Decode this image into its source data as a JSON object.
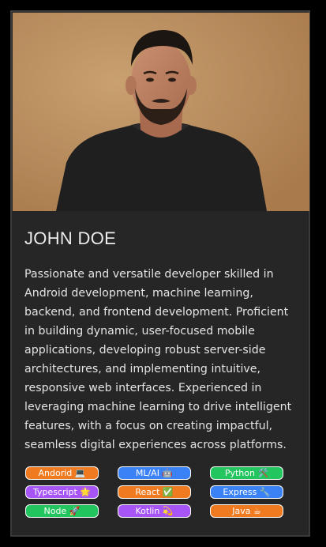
{
  "profile": {
    "name": "JOHN DOE",
    "bio": "Passionate and versatile developer skilled in Android development, machine learning, backend, and frontend development. Proficient in building dynamic, user-focused mobile applications, developing robust server-side architectures, and implementing intuitive, responsive web interfaces. Experienced in leveraging machine learning to drive intelligent features, with a focus on creating impactful, seamless digital experiences across platforms."
  },
  "photo": {
    "icon": "person-portrait"
  },
  "tags": [
    {
      "label": "Andorid 💻",
      "color": "#f07a1f"
    },
    {
      "label": "ML/AI 🤖",
      "color": "#3b82f6"
    },
    {
      "label": "Python 🛠️",
      "color": "#22c55e"
    },
    {
      "label": "Typescript 🌟",
      "color": "#a855f7"
    },
    {
      "label": "React ✅",
      "color": "#f07a1f"
    },
    {
      "label": "Express 🔧",
      "color": "#3b82f6"
    },
    {
      "label": "Node 🚀",
      "color": "#22c55e"
    },
    {
      "label": "Kotlin 💫",
      "color": "#a855f7"
    },
    {
      "label": "Java ☕",
      "color": "#f07a1f"
    }
  ]
}
